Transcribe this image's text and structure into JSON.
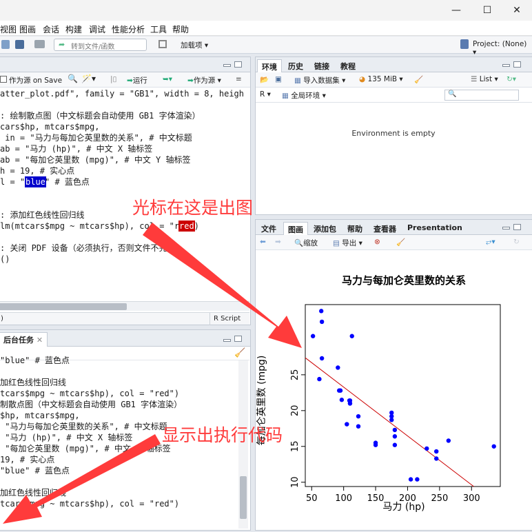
{
  "window": {
    "minimize_glyph": "—",
    "maximize_glyph": "☐",
    "close_glyph": "✕"
  },
  "menu": [
    "视图",
    "图画",
    "会话",
    "构建",
    "调试",
    "性能分析",
    "工具",
    "帮助"
  ],
  "toolbar": {
    "goto_placeholder": "转到文件/函数",
    "addins_label": "加载项",
    "project_label": "Project: (None)"
  },
  "editor": {
    "save_on_save_label": "作为源 on Save",
    "run_label": "运行",
    "source_label": "作为源",
    "lines": [
      "atter_plot.pdf\", family = \"GB1\", width = 8, heigh",
      "",
      ": 绘制散点图（中文标题会自动使用 GB1 字体渲染）",
      "cars$hp, mtcars$mpg,",
      " in = \"马力与每加仑英里数的关系\", # 中文标题",
      "ab = \"马力 (hp)\", # 中文 X 轴标签",
      "ab = \"每加仑英里数 (mpg)\", # 中文 Y 轴标签",
      "h = 19, # 实心点",
      "l = \"blue\" # 蓝色点",
      "",
      "",
      ": 添加红色线性回归线",
      "lm(mtcars$mpg ~ mtcars$hp), col = \"red\")",
      "",
      ": 关闭 PDF 设备（必须执行，否则文件不完整）",
      "()"
    ],
    "highlight_blue": "blue",
    "highlight_red": "red",
    "status_left": ")",
    "status_right": "R Script"
  },
  "console": {
    "tab_label": "后台任务",
    "lines": [
      "\"blue\" # 蓝色点",
      "",
      "加红色线性回归线",
      "tcars$mpg ~ mtcars$hp), col = \"red\")",
      "制散点图（中文标题会自动使用 GB1 字体渲染）",
      "$hp, mtcars$mpg,",
      " \"马力与每加仑英里数的关系\", # 中文标题",
      " \"马力 (hp)\", # 中文 X 轴标签",
      " \"每加仑英里数 (mpg)\", # 中文 Y 轴标签",
      "19, # 实心点",
      "\"blue\" # 蓝色点",
      "",
      "加红色线性回归线",
      "tcars$mpg ~ mtcars$hp), col = \"red\")"
    ]
  },
  "env": {
    "tabs": [
      "环境",
      "历史",
      "链接",
      "教程"
    ],
    "import_label": "导入数据集",
    "memory_label": "135 MiB",
    "list_label": "List",
    "r_label": "R",
    "global_env_label": "全局环境",
    "empty_text": "Environment is empty"
  },
  "plots": {
    "tabs": [
      "文件",
      "图画",
      "添加包",
      "帮助",
      "查看器",
      "Presentation"
    ],
    "zoom_label": "缩放",
    "export_label": "导出"
  },
  "annotations": {
    "cursor_note": "光标在这是出图",
    "exec_note": "显示出执行代码"
  },
  "chart_data": {
    "type": "scatter",
    "title": "马力与每加仑英里数的关系",
    "xlabel": "马力 (hp)",
    "ylabel": "每加仑英里数 (mpg)",
    "xlim": [
      40,
      345
    ],
    "ylim": [
      9.4,
      34.8
    ],
    "xticks": [
      50,
      100,
      150,
      200,
      250,
      300
    ],
    "yticks": [
      10,
      15,
      20,
      25
    ],
    "point_color": "#0000ff",
    "line_color": "#cc0000",
    "regression": {
      "intercept": 30.1,
      "slope": -0.0682
    },
    "points": [
      {
        "x": 110,
        "y": 21.0
      },
      {
        "x": 110,
        "y": 21.0
      },
      {
        "x": 93,
        "y": 22.8
      },
      {
        "x": 110,
        "y": 21.4
      },
      {
        "x": 175,
        "y": 18.7
      },
      {
        "x": 105,
        "y": 18.1
      },
      {
        "x": 245,
        "y": 14.3
      },
      {
        "x": 62,
        "y": 24.4
      },
      {
        "x": 95,
        "y": 22.8
      },
      {
        "x": 123,
        "y": 19.2
      },
      {
        "x": 123,
        "y": 17.8
      },
      {
        "x": 180,
        "y": 16.4
      },
      {
        "x": 180,
        "y": 17.3
      },
      {
        "x": 180,
        "y": 15.2
      },
      {
        "x": 205,
        "y": 10.4
      },
      {
        "x": 215,
        "y": 10.4
      },
      {
        "x": 230,
        "y": 14.7
      },
      {
        "x": 66,
        "y": 32.4
      },
      {
        "x": 52,
        "y": 30.4
      },
      {
        "x": 65,
        "y": 33.9
      },
      {
        "x": 97,
        "y": 21.5
      },
      {
        "x": 150,
        "y": 15.5
      },
      {
        "x": 150,
        "y": 15.2
      },
      {
        "x": 245,
        "y": 13.3
      },
      {
        "x": 175,
        "y": 19.2
      },
      {
        "x": 66,
        "y": 27.3
      },
      {
        "x": 91,
        "y": 26.0
      },
      {
        "x": 113,
        "y": 30.4
      },
      {
        "x": 264,
        "y": 15.8
      },
      {
        "x": 175,
        "y": 19.7
      },
      {
        "x": 335,
        "y": 15.0
      },
      {
        "x": 109,
        "y": 21.4
      }
    ]
  }
}
